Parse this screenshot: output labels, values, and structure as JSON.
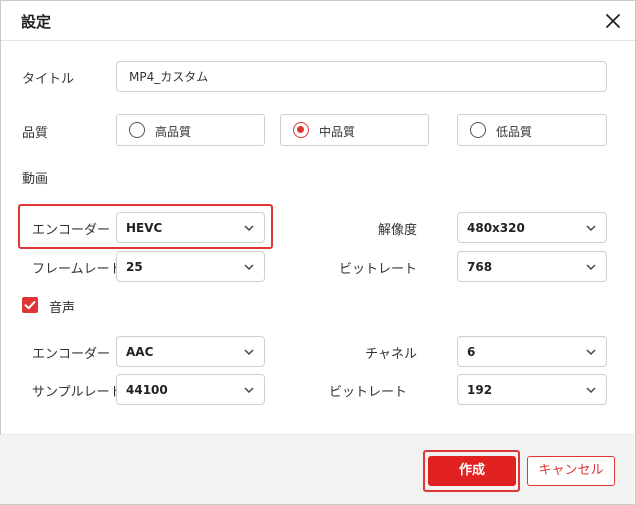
{
  "dialog": {
    "title": "設定",
    "close_icon": "close-icon"
  },
  "title_field": {
    "label": "タイトル",
    "value": "MP4_カスタム"
  },
  "quality": {
    "label": "品質",
    "options": [
      {
        "label": "高品質",
        "selected": false
      },
      {
        "label": "中品質",
        "selected": true
      },
      {
        "label": "低品質",
        "selected": false
      }
    ]
  },
  "video": {
    "section_label": "動画",
    "encoder_label": "エンコーダー",
    "encoder_value": "HEVC",
    "resolution_label": "解像度",
    "resolution_value": "480x320",
    "framerate_label": "フレームレート",
    "framerate_value": "25",
    "bitrate_label": "ビットレート",
    "bitrate_value": "768"
  },
  "audio": {
    "section_label": "音声",
    "enabled": true,
    "encoder_label": "エンコーダー",
    "encoder_value": "AAC",
    "channel_label": "チャネル",
    "channel_value": "6",
    "samplerate_label": "サンプルレート",
    "samplerate_value": "44100",
    "bitrate_label": "ビットレート",
    "bitrate_value": "192"
  },
  "footer": {
    "create_label": "作成",
    "cancel_label": "キャンセル"
  },
  "colors": {
    "accent": "#e03535",
    "primary_button": "#e0211f",
    "footer_bg": "#f2f2f2"
  }
}
